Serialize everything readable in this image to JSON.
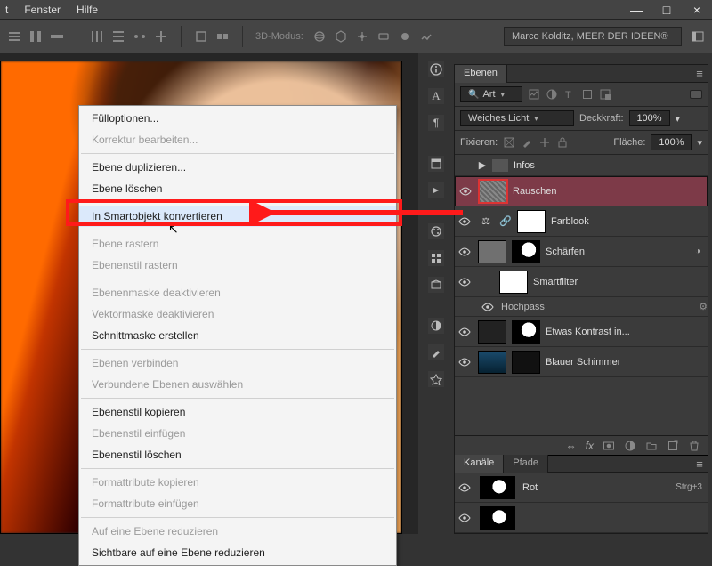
{
  "menubar": {
    "items": [
      "t",
      "Fenster",
      "Hilfe"
    ]
  },
  "window_buttons": {
    "min": "—",
    "max": "□",
    "close": "×"
  },
  "optionsbar": {
    "mode_label": "3D-Modus:",
    "user_box": "Marco Kolditz, MEER DER IDEEN®"
  },
  "context_menu": {
    "items": [
      {
        "label": "Fülloptionen...",
        "enabled": true
      },
      {
        "label": "Korrektur bearbeiten...",
        "enabled": false
      },
      {
        "sep": true
      },
      {
        "label": "Ebene duplizieren...",
        "enabled": true
      },
      {
        "label": "Ebene löschen",
        "enabled": true
      },
      {
        "sep": true
      },
      {
        "label": "In Smartobjekt konvertieren",
        "enabled": true,
        "highlight": true
      },
      {
        "sep": true
      },
      {
        "label": "Ebene rastern",
        "enabled": false
      },
      {
        "label": "Ebenenstil rastern",
        "enabled": false
      },
      {
        "sep": true
      },
      {
        "label": "Ebenenmaske deaktivieren",
        "enabled": false
      },
      {
        "label": "Vektormaske deaktivieren",
        "enabled": false
      },
      {
        "label": "Schnittmaske erstellen",
        "enabled": true
      },
      {
        "sep": true
      },
      {
        "label": "Ebenen verbinden",
        "enabled": false
      },
      {
        "label": "Verbundene Ebenen auswählen",
        "enabled": false
      },
      {
        "sep": true
      },
      {
        "label": "Ebenenstil kopieren",
        "enabled": true
      },
      {
        "label": "Ebenenstil einfügen",
        "enabled": false
      },
      {
        "label": "Ebenenstil löschen",
        "enabled": true
      },
      {
        "sep": true
      },
      {
        "label": "Formattribute kopieren",
        "enabled": false
      },
      {
        "label": "Formattribute einfügen",
        "enabled": false
      },
      {
        "sep": true
      },
      {
        "label": "Auf eine Ebene reduzieren",
        "enabled": false
      },
      {
        "label": "Sichtbare auf eine Ebene reduzieren",
        "enabled": true
      }
    ]
  },
  "layers_panel": {
    "tab": "Ebenen",
    "filter_kind": "Art",
    "blendmode": "Weiches Licht",
    "opacity_label": "Deckkraft:",
    "opacity_value": "100%",
    "lock_label": "Fixieren:",
    "fill_label": "Fläche:",
    "fill_value": "100%",
    "group": {
      "name": "Infos"
    },
    "layers": [
      {
        "name": "Rauschen",
        "thumb": "noise",
        "selected": true
      },
      {
        "name": "Farblook",
        "thumb": "white",
        "adj": true
      },
      {
        "name": "Schärfen",
        "thumb": "gray",
        "mask": "bw",
        "fx": true
      },
      {
        "name": "Smartfilter",
        "thumb": "white",
        "indent": true
      },
      {
        "name": "Hochpass",
        "sub": true
      },
      {
        "name": "Etwas Kontrast in...",
        "thumb": "dark",
        "mask": "bw"
      },
      {
        "name": "Blauer Schimmer",
        "thumb": "blue",
        "mask": "dark"
      }
    ],
    "footer_icons": [
      "link",
      "fx",
      "mask",
      "adj",
      "group",
      "new",
      "trash"
    ]
  },
  "channels_panel": {
    "tabs": [
      "Kanäle",
      "Pfade"
    ],
    "rows": [
      {
        "name": "Rot",
        "shortcut": "Strg+3"
      },
      {
        "name": "",
        "shortcut": ""
      }
    ]
  },
  "glyphs": {
    "eye": "",
    "search": "🔍",
    "triangle_right": "▶",
    "triangle_down": "▾",
    "hamburger": "≡"
  }
}
